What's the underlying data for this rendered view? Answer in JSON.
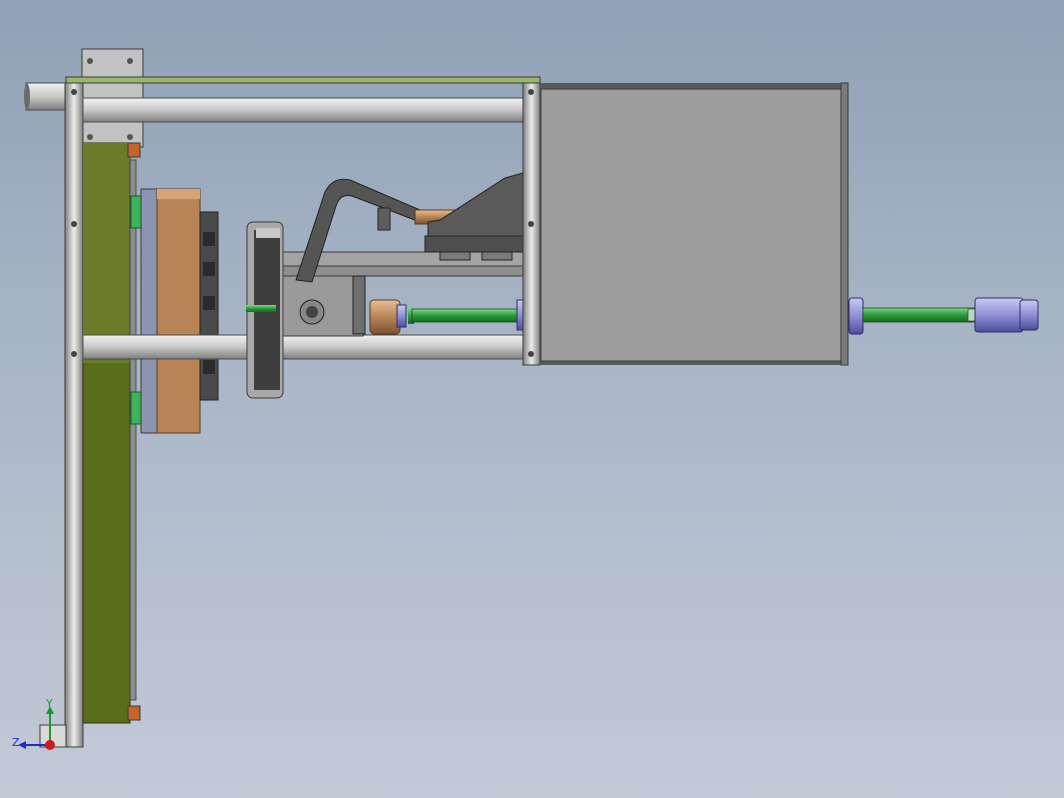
{
  "viewport": {
    "background_top": "#8fa1b6",
    "background_bottom": "#c3cad7"
  },
  "triad": {
    "axis_y_label": "Y",
    "axis_z_label": "Z",
    "colors": {
      "y": "#1a9a2a",
      "z": "#1a2fd0",
      "x": "#d01a1a"
    }
  },
  "colors": {
    "frame_outline": "#3a3a3a",
    "frame_fill": "#b4b4b4",
    "rod_light": "#e6e6e6",
    "rod_dark": "#8c8c8c",
    "green_plate": "#5a6e1a",
    "box_fill": "#9e9e9e",
    "copper": "#b88456",
    "lavender": "#8f8fd6",
    "shaft_green": "#2d9a3a",
    "dark_part": "#4a4a4a",
    "accent_orange": "#c4632e"
  }
}
